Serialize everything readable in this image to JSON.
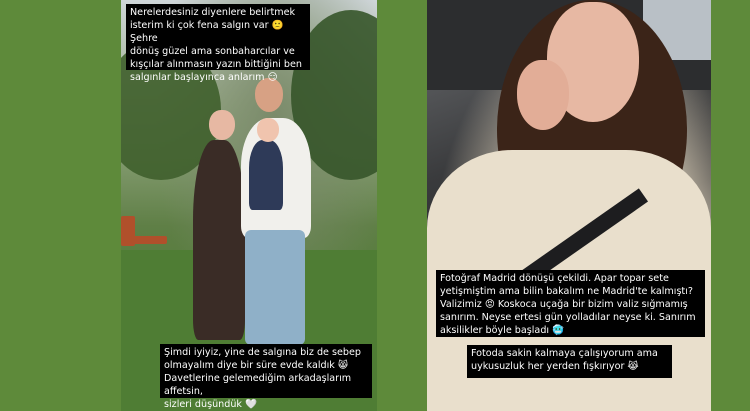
{
  "left_story": {
    "caption_top": "Nerelerdesiniz diyenlere belirtmek\nisterim ki çok fena salgın var 🙁 Şehre\ndönüş güzel ama sonbaharcılar ve\nkışçılar alınmasın yazın bittiğini ben\nsalgınlar başlayınca anlarım 😏",
    "caption_bottom": "Şimdi iyiyiz, yine de salgına biz de sebep\nolmayalım diye bir süre evde kaldık 😸\nDavetlerine gelemediğim arkadaşlarım affetsin,\nsizleri düşündük 🤍"
  },
  "right_story": {
    "caption_main": "Fotoğraf Madrid dönüşü çekildi. Apar topar sete\nyetişmiştim ama bilin bakalım ne Madrid'te kalmıştı?\nValizimiz 😡 Koskoca uçağa bir bizim valiz sığmamış\nsanırım. Neyse ertesi gün yolladılar neyse ki. Sanırım\naksilikler böyle başladı 🥶",
    "caption_secondary": "Fotoda sakin kalmaya çalışıyorum ama\nuykusuzluk her yerden fışkırıyor 😹"
  },
  "colors": {
    "background": "#5e8a3a",
    "caption_bg": "#000000",
    "caption_text": "#ffffff"
  }
}
